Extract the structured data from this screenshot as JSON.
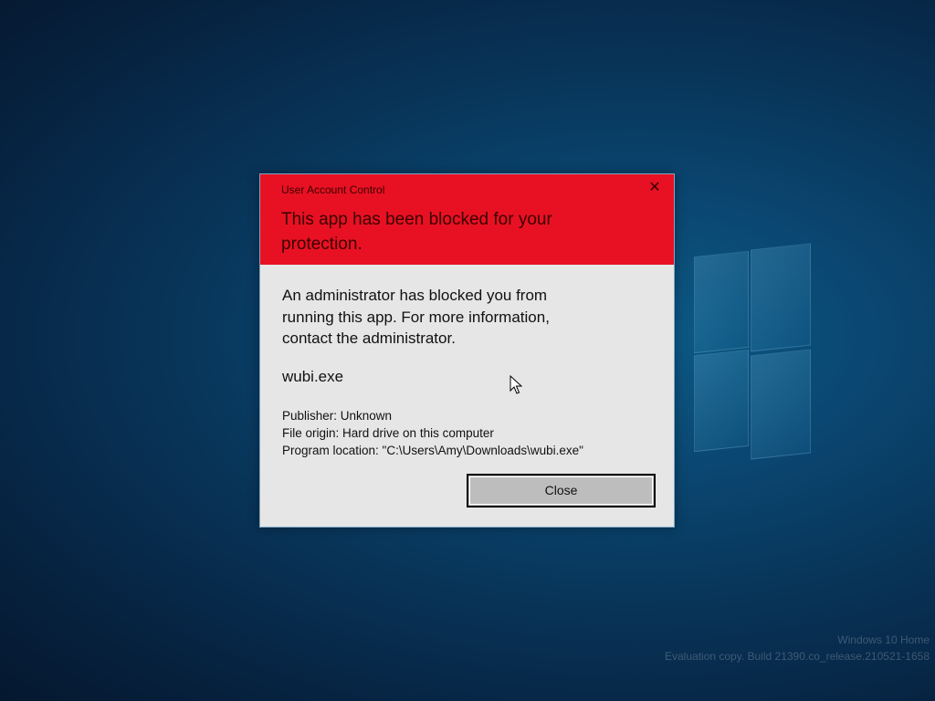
{
  "dialog": {
    "caption": "User Account Control",
    "close_glyph": "✕",
    "headline": "This app has been blocked for your protection.",
    "message": "An administrator has blocked you from running this app. For more information, contact the administrator.",
    "program_name": "wubi.exe",
    "publisher": "Publisher: Unknown",
    "file_origin": "File origin: Hard drive on this computer",
    "program_location": "Program location: \"C:\\Users\\Amy\\Downloads\\wubi.exe\"",
    "close_button_label": "Close",
    "header_color": "#e81123",
    "body_color": "#e6e6e6"
  },
  "watermark": {
    "line1": "Windows 10 Home",
    "line2": "Evaluation copy. Build 21390.co_release.210521-1658"
  },
  "icons": {
    "close": "close-icon",
    "cursor": "mouse-pointer-icon",
    "logo": "windows-logo"
  }
}
